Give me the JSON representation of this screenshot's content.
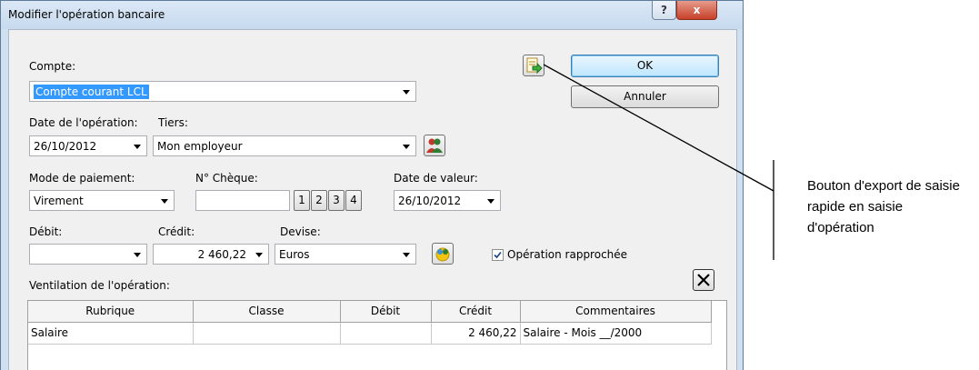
{
  "window": {
    "title": "Modifier l'opération bancaire",
    "help_label": "?",
    "close_label": "x"
  },
  "compte": {
    "label": "Compte:",
    "value": "Compte courant LCL"
  },
  "buttons": {
    "ok": "OK",
    "cancel": "Annuler"
  },
  "date_operation": {
    "label": "Date de l'opération:",
    "value": "26/10/2012"
  },
  "tiers": {
    "label": "Tiers:",
    "value": "Mon employeur"
  },
  "mode_paiement": {
    "label": "Mode de paiement:",
    "value": "Virement"
  },
  "cheque": {
    "label": "N° Chèque:",
    "value": "",
    "quick_buttons": [
      "1",
      "2",
      "3",
      "4"
    ]
  },
  "date_valeur": {
    "label": "Date de valeur:",
    "value": "26/10/2012"
  },
  "debit": {
    "label": "Débit:",
    "value": ""
  },
  "credit": {
    "label": "Crédit:",
    "value": "2 460,22"
  },
  "devise": {
    "label": "Devise:",
    "value": "Euros"
  },
  "rapprochee": {
    "label": "Opération rapprochée",
    "checked": true
  },
  "ventilation": {
    "label": "Ventilation de l'opération:",
    "columns": [
      "Rubrique",
      "Classe",
      "Débit",
      "Crédit",
      "Commentaires"
    ],
    "rows": [
      {
        "rubrique": "Salaire",
        "classe": "",
        "debit": "",
        "credit": "2 460,22",
        "commentaires": "Salaire - Mois __/2000"
      }
    ]
  },
  "annotation": {
    "text": "Bouton d'export de saisie rapide en saisie d'opération"
  },
  "icons": {
    "export": "export-icon",
    "tiers": "people-icon",
    "devise": "currency-icon",
    "delete": "delete-x-icon"
  }
}
